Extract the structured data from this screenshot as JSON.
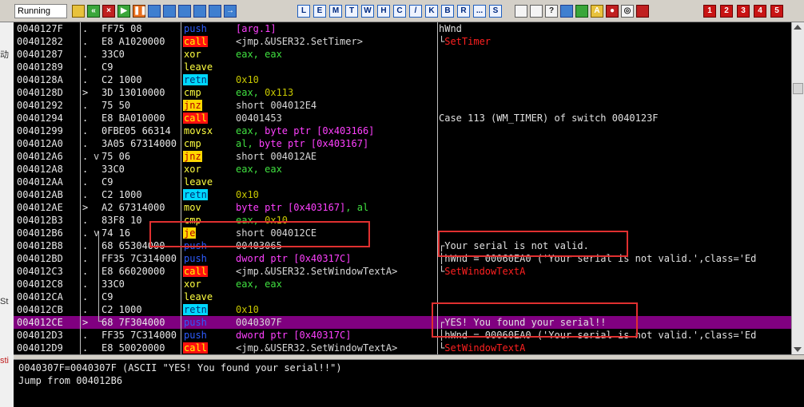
{
  "toolbar": {
    "status": "Running",
    "buttons": [
      {
        "name": "open-icon",
        "glyph": "",
        "style": "yellow"
      },
      {
        "name": "restart-icon",
        "glyph": "«",
        "style": "green"
      },
      {
        "name": "close-icon",
        "glyph": "×",
        "style": "red"
      },
      {
        "name": "run-icon",
        "glyph": "▶",
        "style": "green"
      },
      {
        "name": "pause-icon",
        "glyph": "❚❚",
        "style": "orange"
      },
      {
        "name": "step-into-icon",
        "glyph": "",
        "style": "blue"
      },
      {
        "name": "step-over-icon",
        "glyph": "",
        "style": "blue"
      },
      {
        "name": "trace-into-icon",
        "glyph": "",
        "style": "blue"
      },
      {
        "name": "trace-over-icon",
        "glyph": "",
        "style": "blue"
      },
      {
        "name": "execute-till-return-icon",
        "glyph": "",
        "style": "blue"
      },
      {
        "name": "go-to-icon",
        "glyph": "→",
        "style": "blue"
      }
    ],
    "letters": [
      "L",
      "E",
      "M",
      "T",
      "W",
      "H",
      "C",
      "/",
      "K",
      "B",
      "R",
      "...",
      "S"
    ],
    "right_buttons": [
      {
        "name": "list-icon",
        "glyph": "",
        "style": "white"
      },
      {
        "name": "grid-icon",
        "glyph": "",
        "style": "white"
      },
      {
        "name": "help-icon",
        "glyph": "?",
        "style": "white"
      },
      {
        "name": "refresh-icon",
        "glyph": "",
        "style": "blue"
      },
      {
        "name": "hw-icon",
        "glyph": "",
        "style": "green"
      },
      {
        "name": "font-icon",
        "glyph": "A",
        "style": "yellow"
      },
      {
        "name": "record-icon",
        "glyph": "●",
        "style": "red"
      },
      {
        "name": "target-icon",
        "glyph": "◎",
        "style": "white"
      },
      {
        "name": "plugin-icon",
        "glyph": "",
        "style": "red"
      }
    ],
    "numbers": [
      "1",
      "2",
      "3",
      "4",
      "5"
    ]
  },
  "left_strip": [
    "动",
    "St",
    "sti"
  ],
  "disasm": [
    {
      "addr": "0040127F",
      "mark": ".",
      "jarrow": "",
      "hex": "FF75 08",
      "mn": "push",
      "cls": "m-push",
      "ops": [
        {
          "t": "[arg.1]",
          "c": "op-mem"
        }
      ],
      "comment": [
        {
          "t": "hWnd",
          "c": "cm-txt"
        }
      ],
      "bracket": ""
    },
    {
      "addr": "00401282",
      "mark": ".",
      "jarrow": "",
      "hex": "E8 A1020000",
      "mn": "call",
      "cls": "m-call",
      "ops": [
        {
          "t": "<jmp.&USER32.SetTimer>",
          "c": "op-addr"
        }
      ],
      "comment": [
        {
          "t": "SetTimer",
          "c": "cm-api"
        }
      ],
      "bracket": "└"
    },
    {
      "addr": "00401287",
      "mark": ".",
      "jarrow": "",
      "hex": "33C0",
      "mn": "xor",
      "cls": "m-xor",
      "ops": [
        {
          "t": "eax, eax",
          "c": "op-reg"
        }
      ],
      "comment": [],
      "bracket": ""
    },
    {
      "addr": "00401289",
      "mark": ".",
      "jarrow": "",
      "hex": "C9",
      "mn": "leave",
      "cls": "m-leave",
      "ops": [],
      "comment": [],
      "bracket": ""
    },
    {
      "addr": "0040128A",
      "mark": ".",
      "jarrow": "",
      "hex": "C2 1000",
      "mn": "retn",
      "cls": "m-retn",
      "ops": [
        {
          "t": "0x10",
          "c": "op-num"
        }
      ],
      "comment": [],
      "bracket": ""
    },
    {
      "addr": "0040128D",
      "mark": ">",
      "jarrow": "",
      "hex": "3D 13010000",
      "mn": "cmp",
      "cls": "m-cmp",
      "ops": [
        {
          "t": "eax, ",
          "c": "op-reg"
        },
        {
          "t": "0x113",
          "c": "op-num"
        }
      ],
      "comment": [],
      "bracket": ""
    },
    {
      "addr": "00401292",
      "mark": ".",
      "jarrow": "",
      "hex": "75 50",
      "mn": "jnz",
      "cls": "m-jnz",
      "ops": [
        {
          "t": "short 004012E4",
          "c": "op-addr"
        }
      ],
      "comment": [],
      "bracket": ""
    },
    {
      "addr": "00401294",
      "mark": ".",
      "jarrow": "",
      "hex": "E8 BA010000",
      "mn": "call",
      "cls": "m-call",
      "ops": [
        {
          "t": "00401453",
          "c": "op-addr"
        }
      ],
      "comment": [
        {
          "t": "Case 113 (WM_TIMER) of switch 0040123F",
          "c": "cm-txt"
        }
      ],
      "bracket": ""
    },
    {
      "addr": "00401299",
      "mark": ".",
      "jarrow": "",
      "hex": "0FBE05 66314",
      "mn": "movsx",
      "cls": "m-movsx",
      "ops": [
        {
          "t": "eax, ",
          "c": "op-reg"
        },
        {
          "t": "byte ptr [0x403166]",
          "c": "op-mem"
        }
      ],
      "comment": [],
      "bracket": ""
    },
    {
      "addr": "004012A0",
      "mark": ".",
      "jarrow": "",
      "hex": "3A05 67314000",
      "mn": "cmp",
      "cls": "m-cmp",
      "ops": [
        {
          "t": "al, ",
          "c": "op-reg"
        },
        {
          "t": "byte ptr [0x403167]",
          "c": "op-mem"
        }
      ],
      "comment": [],
      "bracket": ""
    },
    {
      "addr": "004012A6",
      "mark": ".",
      "jarrow": "v",
      "hex": "75 06",
      "mn": "jnz",
      "cls": "m-jnz",
      "ops": [
        {
          "t": "short 004012AE",
          "c": "op-addr"
        }
      ],
      "comment": [],
      "bracket": ""
    },
    {
      "addr": "004012A8",
      "mark": ".",
      "jarrow": "",
      "hex": "33C0",
      "mn": "xor",
      "cls": "m-xor",
      "ops": [
        {
          "t": "eax, eax",
          "c": "op-reg"
        }
      ],
      "comment": [],
      "bracket": ""
    },
    {
      "addr": "004012AA",
      "mark": ".",
      "jarrow": "",
      "hex": "C9",
      "mn": "leave",
      "cls": "m-leave",
      "ops": [],
      "comment": [],
      "bracket": ""
    },
    {
      "addr": "004012AB",
      "mark": ".",
      "jarrow": "",
      "hex": "C2 1000",
      "mn": "retn",
      "cls": "m-retn",
      "ops": [
        {
          "t": "0x10",
          "c": "op-num"
        }
      ],
      "comment": [],
      "bracket": ""
    },
    {
      "addr": "004012AE",
      "mark": ">",
      "jarrow": "",
      "hex": "A2 67314000",
      "mn": "mov",
      "cls": "m-mov",
      "ops": [
        {
          "t": "byte ptr [0x403167]",
          "c": "op-mem"
        },
        {
          "t": ", al",
          "c": "op-reg"
        }
      ],
      "comment": [],
      "bracket": ""
    },
    {
      "addr": "004012B3",
      "mark": ".",
      "jarrow": "",
      "hex": "83F8 10",
      "mn": "cmp",
      "cls": "m-cmp",
      "ops": [
        {
          "t": "eax, ",
          "c": "op-reg"
        },
        {
          "t": "0x10",
          "c": "op-num"
        }
      ],
      "comment": [],
      "bracket": ""
    },
    {
      "addr": "004012B6",
      "mark": ".",
      "jarrow": "v",
      "hex": "74 16",
      "mn": "je",
      "cls": "m-je",
      "ops": [
        {
          "t": "short 004012CE",
          "c": "op-addr"
        }
      ],
      "comment": [],
      "bracket": ""
    },
    {
      "addr": "004012B8",
      "mark": ".",
      "jarrow": "",
      "hex": "68 65304000",
      "mn": "push",
      "cls": "m-push",
      "ops": [
        {
          "t": "00403065",
          "c": "op-addr"
        }
      ],
      "comment": [
        {
          "t": "Your serial is not valid.",
          "c": "cm-txt"
        }
      ],
      "bracket": "┌"
    },
    {
      "addr": "004012BD",
      "mark": ".",
      "jarrow": "",
      "hex": "FF35 7C314000",
      "mn": "push",
      "cls": "m-push",
      "ops": [
        {
          "t": "dword ptr [0x40317C]",
          "c": "op-mem"
        }
      ],
      "comment": [
        {
          "t": "hWnd = 00060EA0 ('Your serial is not valid.',class='Ed",
          "c": "cm-txt"
        }
      ],
      "bracket": "│"
    },
    {
      "addr": "004012C3",
      "mark": ".",
      "jarrow": "",
      "hex": "E8 66020000",
      "mn": "call",
      "cls": "m-call",
      "ops": [
        {
          "t": "<jmp.&USER32.SetWindowTextA>",
          "c": "op-addr"
        }
      ],
      "comment": [
        {
          "t": "SetWindowTextA",
          "c": "cm-api"
        }
      ],
      "bracket": "└"
    },
    {
      "addr": "004012C8",
      "mark": ".",
      "jarrow": "",
      "hex": "33C0",
      "mn": "xor",
      "cls": "m-xor",
      "ops": [
        {
          "t": "eax, eax",
          "c": "op-reg"
        }
      ],
      "comment": [],
      "bracket": ""
    },
    {
      "addr": "004012CA",
      "mark": ".",
      "jarrow": "",
      "hex": "C9",
      "mn": "leave",
      "cls": "m-leave",
      "ops": [],
      "comment": [],
      "bracket": ""
    },
    {
      "addr": "004012CB",
      "mark": ".",
      "jarrow": "",
      "hex": "C2 1000",
      "mn": "retn",
      "cls": "m-retn",
      "ops": [
        {
          "t": "0x10",
          "c": "op-num"
        }
      ],
      "comment": [],
      "bracket": ""
    },
    {
      "addr": "004012CE",
      "mark": ">",
      "jarrow": "",
      "hex": "68 7F304000",
      "mn": "push",
      "cls": "m-push",
      "ops": [
        {
          "t": "0040307F",
          "c": "op-addr"
        }
      ],
      "comment": [
        {
          "t": "YES! You found your serial!!",
          "c": "cm-txt"
        }
      ],
      "bracket": "┌",
      "selected": true
    },
    {
      "addr": "004012D3",
      "mark": ".",
      "jarrow": "",
      "hex": "FF35 7C314000",
      "mn": "push",
      "cls": "m-push",
      "ops": [
        {
          "t": "dword ptr [0x40317C]",
          "c": "op-mem"
        }
      ],
      "comment": [
        {
          "t": "hWnd = 00060EA0 ('Your serial is not valid.',class='Ed",
          "c": "cm-txt"
        }
      ],
      "bracket": "│"
    },
    {
      "addr": "004012D9",
      "mark": ".",
      "jarrow": "",
      "hex": "E8 50020000",
      "mn": "call",
      "cls": "m-call",
      "ops": [
        {
          "t": "<jmp.&USER32.SetWindowTextA>",
          "c": "op-addr"
        }
      ],
      "comment": [
        {
          "t": "SetWindowTextA",
          "c": "cm-api"
        }
      ],
      "bracket": "└"
    }
  ],
  "info": {
    "line1": "0040307F=0040307F (ASCII \"YES! You found your serial!!\")",
    "line2": "Jump from 004012B6"
  },
  "colors": {
    "selection": "#800080",
    "annotation": "#e03030"
  }
}
